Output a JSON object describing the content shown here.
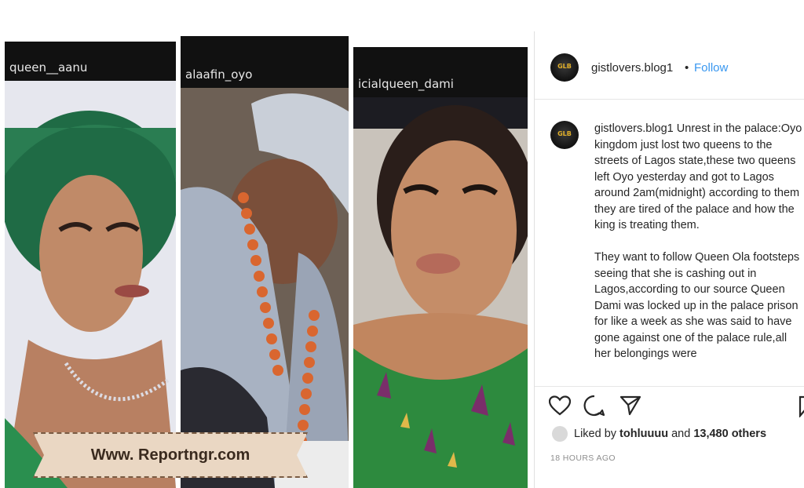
{
  "panels": [
    {
      "username": "queen__aanu",
      "photo": "woman in green gele headwrap with crystal necklace"
    },
    {
      "username": "alaafin_oyo",
      "photo": "elderly king in white cap with coral bead necklaces"
    },
    {
      "username": "icialqueen_dami",
      "photo": "woman in green ankara print dress"
    }
  ],
  "watermark": {
    "text": "Www. Reportngr.com"
  },
  "post": {
    "account": {
      "avatar_text": "GLB",
      "username": "gistlovers.blog1",
      "separator": "•",
      "follow_label": "Follow"
    },
    "caption": {
      "username": "gistlovers.blog1",
      "text": " Unrest in the palace:Oyo kingdom just lost two queens to the streets of Lagos state,these two queens left Oyo yesterday and got to Lagos around 2am(midnight) according to them they are tired of the palace and how the king is treating them.\n\nThey want to follow Queen Ola footsteps seeing that she is cashing out in Lagos,according to our source Queen Dami was locked up in the palace prison for like a week as she was said to have gone against one of the palace rule,all her belongings were"
    },
    "actions": {
      "like_icon": "heart-icon",
      "comment_icon": "comment-icon",
      "share_icon": "share-icon",
      "save_icon": "bookmark-icon"
    },
    "likes": {
      "prefix": "Liked by ",
      "user": "tohluuuu",
      "middle": " and ",
      "others": "13,480 others"
    },
    "timestamp": "18 HOURS AGO"
  }
}
